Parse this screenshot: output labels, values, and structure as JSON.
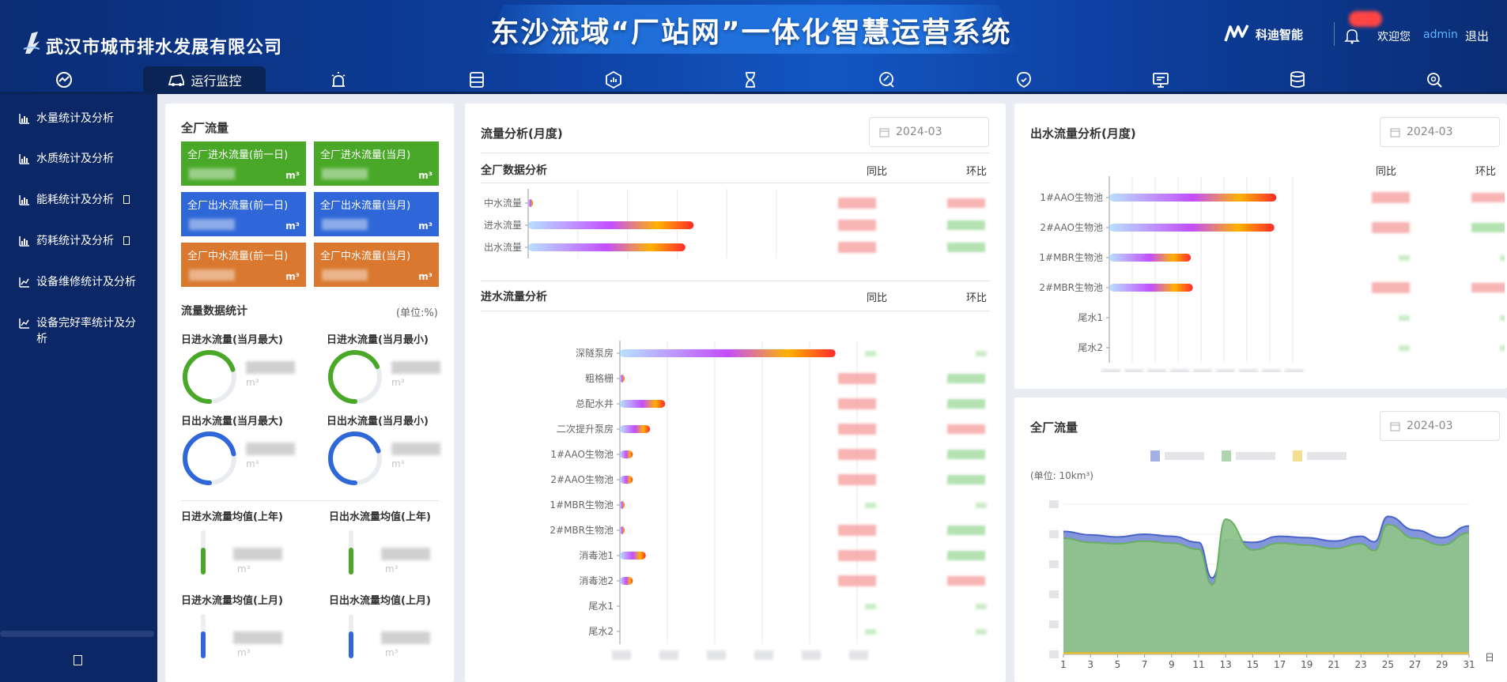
{
  "header": {
    "org_name": "武汉市城市排水发展有限公司",
    "system_title": "东沙流域“厂站网”一体化智慧运营系统",
    "brand": "科迪智能",
    "welcome": "欢迎您",
    "username": "admin",
    "logout": "退出"
  },
  "nav": {
    "active_label": "运行监控",
    "icons": [
      "dashboard-icon",
      "monitor-car-icon",
      "alarm-icon",
      "server-icon",
      "report-icon",
      "hourglass-icon",
      "maintenance-icon",
      "inspection-icon",
      "screen-icon",
      "database-icon",
      "search-settings-icon"
    ]
  },
  "sidebar": {
    "items": [
      {
        "label": "水量统计及分析"
      },
      {
        "label": "水质统计及分析"
      },
      {
        "label": "能耗统计及分析"
      },
      {
        "label": "药耗统计及分析"
      },
      {
        "label": "设备维修统计及分析"
      },
      {
        "label": "设备完好率统计及分析"
      }
    ]
  },
  "plant_flow": {
    "title": "全厂流量",
    "cards": [
      {
        "label": "全厂进水流量(前一日)",
        "unit": "m³",
        "color": "#4aa829"
      },
      {
        "label": "全厂进水流量(当月)",
        "unit": "m³",
        "color": "#4aa829"
      },
      {
        "label": "全厂出水流量(前一日)",
        "unit": "m³",
        "color": "#2f67d8"
      },
      {
        "label": "全厂出水流量(当月)",
        "unit": "m³",
        "color": "#2f67d8"
      },
      {
        "label": "全厂中水流量(前一日)",
        "unit": "m³",
        "color": "#d9782e"
      },
      {
        "label": "全厂中水流量(当月)",
        "unit": "m³",
        "color": "#d9782e"
      }
    ],
    "stats_title": "流量数据统计",
    "stats_unit": "(单位:%)",
    "gauges": [
      {
        "label": "日进水流量(当月最大)",
        "unit": "m³",
        "color": "#4aa829",
        "fraction": 0.7
      },
      {
        "label": "日进水流量(当月最小)",
        "unit": "m³",
        "color": "#4aa829",
        "fraction": 0.68
      },
      {
        "label": "日出水流量(当月最大)",
        "unit": "m³",
        "color": "#2f67d8",
        "fraction": 0.72
      },
      {
        "label": "日出水流量(当月最小)",
        "unit": "m³",
        "color": "#2f67d8",
        "fraction": 0.7
      }
    ],
    "averages": [
      {
        "label": "日进水流量均值(上年)",
        "unit": "m³",
        "color": "#4aa829",
        "fraction": 0.6
      },
      {
        "label": "日出水流量均值(上年)",
        "unit": "m³",
        "color": "#4aa829",
        "fraction": 0.6
      },
      {
        "label": "日进水流量均值(上月)",
        "unit": "m³",
        "color": "#2f67d8",
        "fraction": 0.6
      },
      {
        "label": "日出水流量均值(上月)",
        "unit": "m³",
        "color": "#2f67d8",
        "fraction": 0.6
      }
    ]
  },
  "flow_analysis": {
    "title": "流量分析(月度)",
    "date": "2024-03",
    "plant_section": "全厂数据分析",
    "inflow_section": "进水流量分析",
    "yoy": "同比",
    "mom": "环比"
  },
  "outflow_analysis": {
    "title": "出水流量分析(月度)",
    "date": "2024-03",
    "yoy": "同比",
    "mom": "环比"
  },
  "total_flow": {
    "title": "全厂流量",
    "date": "2024-03",
    "unit_label": "(单位: 10km³)",
    "x_unit": "日"
  },
  "chart_data": [
    {
      "type": "bar",
      "orientation": "horizontal",
      "categories": [
        "中水流量",
        "进水流量",
        "出水流量"
      ],
      "values": [
        0.3,
        40,
        38
      ],
      "ylim": [
        0,
        60
      ]
    },
    {
      "type": "bar",
      "orientation": "horizontal",
      "categories": [
        "深隧泵房",
        "粗格栅",
        "总配水井",
        "二次提升泵房",
        "1#AAO生物池",
        "2#AAO生物池",
        "1#MBR生物池",
        "2#MBR生物池",
        "消毒池1",
        "消毒池2",
        "尾水1",
        "尾水2"
      ],
      "values": [
        100,
        0.8,
        21,
        14,
        6,
        6,
        1.5,
        1.5,
        12,
        6,
        0,
        0
      ],
      "ylim": [
        0,
        110
      ]
    },
    {
      "type": "bar",
      "orientation": "horizontal",
      "categories": [
        "1#AAO生物池",
        "2#AAO生物池",
        "1#MBR生物池",
        "2#MBR生物池",
        "尾水1",
        "尾水2"
      ],
      "values": [
        41,
        40.5,
        20,
        20.5,
        0,
        0
      ],
      "ylim": [
        0,
        45
      ]
    },
    {
      "type": "area",
      "x": [
        1,
        3,
        5,
        7,
        9,
        11,
        12,
        13,
        15,
        17,
        19,
        21,
        23,
        24,
        25,
        27,
        29,
        31
      ],
      "series": [
        {
          "values": [
            18,
            17.5,
            17.2,
            17.6,
            17.3,
            16.4,
            11.2,
            16.8,
            16.4,
            17.3,
            17.1,
            16.6,
            17.3,
            16.5,
            20.2,
            18.2,
            17.1,
            18.8
          ],
          "color": "#7c8fd9"
        },
        {
          "values": [
            17,
            16.4,
            16.2,
            16.6,
            16.3,
            15.4,
            10.2,
            19.8,
            15.3,
            16.3,
            16.0,
            15.5,
            16.2,
            15.2,
            19.0,
            17.0,
            16.0,
            17.8
          ],
          "color": "#8fc28b"
        },
        {
          "values": [
            0.2,
            0.2,
            0.2,
            0.2,
            0.2,
            0.2,
            0.2,
            0.2,
            0.2,
            0.2,
            0.2,
            0.2,
            0.2,
            0.2,
            0.2,
            0.2,
            0.2,
            0.2
          ],
          "color": "#f0d060"
        }
      ],
      "xticks": [
        "1",
        "3",
        "5",
        "7",
        "9",
        "11",
        "13",
        "15",
        "17",
        "19",
        "21",
        "23",
        "25",
        "27",
        "29",
        "31"
      ],
      "xlabel": "日",
      "ylabel": "(单位: 10km³)",
      "ylim": [
        0,
        22
      ]
    }
  ]
}
